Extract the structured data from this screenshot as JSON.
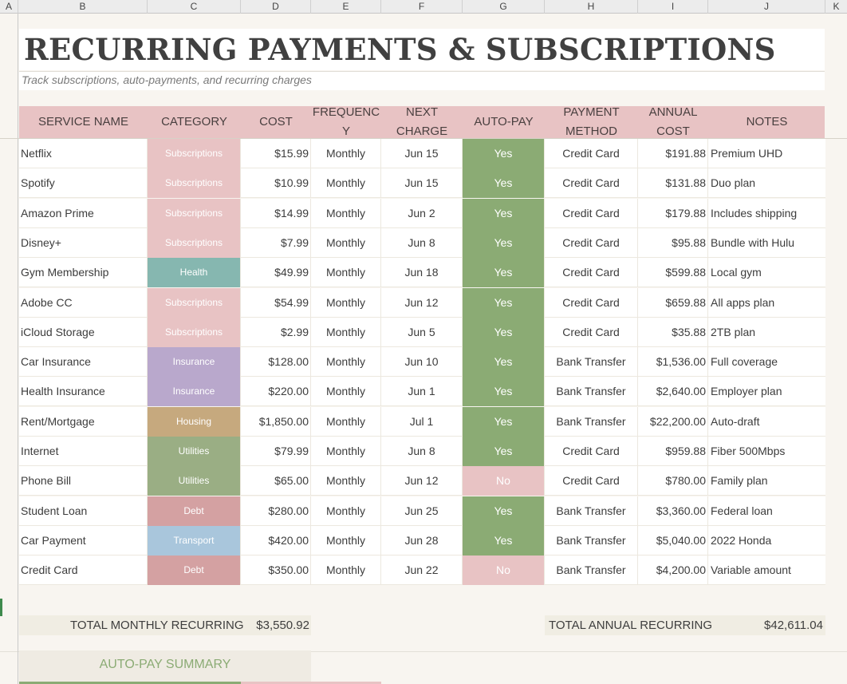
{
  "columns": [
    "A",
    "B",
    "C",
    "D",
    "E",
    "F",
    "G",
    "H",
    "I",
    "J",
    "K"
  ],
  "title": "RECURRING PAYMENTS & SUBSCRIPTIONS",
  "subtitle": "Track subscriptions, auto-payments, and recurring charges",
  "headers": {
    "service": "SERVICE NAME",
    "category": "CATEGORY",
    "cost": "COST",
    "frequency": "FREQUENC\nY",
    "next_charge": "NEXT\nCHARGE",
    "autopay": "AUTO-PAY",
    "payment_method": "PAYMENT\nMETHOD",
    "annual_cost": "ANNUAL\nCOST",
    "notes": "NOTES"
  },
  "category_colors": {
    "Subscriptions": "#e8c3c4",
    "Health": "#86b7b0",
    "Insurance": "#b9a8cc",
    "Housing": "#c6a97e",
    "Utilities": "#9aae84",
    "Debt": "#d4a1a2",
    "Transport": "#a9c6dc"
  },
  "autopay_colors": {
    "Yes": "#8bab74",
    "No": "#e8c3c4"
  },
  "rows": [
    {
      "service": "Netflix",
      "category": "Subscriptions",
      "cost": "$15.99",
      "frequency": "Monthly",
      "next_charge": "Jun 15",
      "autopay": "Yes",
      "payment_method": "Credit Card",
      "annual_cost": "$191.88",
      "notes": "Premium UHD"
    },
    {
      "service": "Spotify",
      "category": "Subscriptions",
      "cost": "$10.99",
      "frequency": "Monthly",
      "next_charge": "Jun 15",
      "autopay": "Yes",
      "payment_method": "Credit Card",
      "annual_cost": "$131.88",
      "notes": "Duo plan"
    },
    {
      "service": "Amazon Prime",
      "category": "Subscriptions",
      "cost": "$14.99",
      "frequency": "Monthly",
      "next_charge": "Jun 2",
      "autopay": "Yes",
      "payment_method": "Credit Card",
      "annual_cost": "$179.88",
      "notes": "Includes shipping"
    },
    {
      "service": "Disney+",
      "category": "Subscriptions",
      "cost": "$7.99",
      "frequency": "Monthly",
      "next_charge": "Jun 8",
      "autopay": "Yes",
      "payment_method": "Credit Card",
      "annual_cost": "$95.88",
      "notes": "Bundle with Hulu"
    },
    {
      "service": "Gym Membership",
      "category": "Health",
      "cost": "$49.99",
      "frequency": "Monthly",
      "next_charge": "Jun 18",
      "autopay": "Yes",
      "payment_method": "Credit Card",
      "annual_cost": "$599.88",
      "notes": "Local gym"
    },
    {
      "service": "Adobe CC",
      "category": "Subscriptions",
      "cost": "$54.99",
      "frequency": "Monthly",
      "next_charge": "Jun 12",
      "autopay": "Yes",
      "payment_method": "Credit Card",
      "annual_cost": "$659.88",
      "notes": "All apps plan"
    },
    {
      "service": "iCloud Storage",
      "category": "Subscriptions",
      "cost": "$2.99",
      "frequency": "Monthly",
      "next_charge": "Jun 5",
      "autopay": "Yes",
      "payment_method": "Credit Card",
      "annual_cost": "$35.88",
      "notes": "2TB plan"
    },
    {
      "service": "Car Insurance",
      "category": "Insurance",
      "cost": "$128.00",
      "frequency": "Monthly",
      "next_charge": "Jun 10",
      "autopay": "Yes",
      "payment_method": "Bank Transfer",
      "annual_cost": "$1,536.00",
      "notes": "Full coverage"
    },
    {
      "service": "Health Insurance",
      "category": "Insurance",
      "cost": "$220.00",
      "frequency": "Monthly",
      "next_charge": "Jun 1",
      "autopay": "Yes",
      "payment_method": "Bank Transfer",
      "annual_cost": "$2,640.00",
      "notes": "Employer plan"
    },
    {
      "service": "Rent/Mortgage",
      "category": "Housing",
      "cost": "$1,850.00",
      "frequency": "Monthly",
      "next_charge": "Jul 1",
      "autopay": "Yes",
      "payment_method": "Bank Transfer",
      "annual_cost": "$22,200.00",
      "notes": "Auto-draft"
    },
    {
      "service": "Internet",
      "category": "Utilities",
      "cost": "$79.99",
      "frequency": "Monthly",
      "next_charge": "Jun 8",
      "autopay": "Yes",
      "payment_method": "Credit Card",
      "annual_cost": "$959.88",
      "notes": "Fiber 500Mbps"
    },
    {
      "service": "Phone Bill",
      "category": "Utilities",
      "cost": "$65.00",
      "frequency": "Monthly",
      "next_charge": "Jun 12",
      "autopay": "No",
      "payment_method": "Credit Card",
      "annual_cost": "$780.00",
      "notes": "Family plan"
    },
    {
      "service": "Student Loan",
      "category": "Debt",
      "cost": "$280.00",
      "frequency": "Monthly",
      "next_charge": "Jun 25",
      "autopay": "Yes",
      "payment_method": "Bank Transfer",
      "annual_cost": "$3,360.00",
      "notes": "Federal loan"
    },
    {
      "service": "Car Payment",
      "category": "Transport",
      "cost": "$420.00",
      "frequency": "Monthly",
      "next_charge": "Jun 28",
      "autopay": "Yes",
      "payment_method": "Bank Transfer",
      "annual_cost": "$5,040.00",
      "notes": "2022 Honda"
    },
    {
      "service": "Credit Card",
      "category": "Debt",
      "cost": "$350.00",
      "frequency": "Monthly",
      "next_charge": "Jun 22",
      "autopay": "No",
      "payment_method": "Bank Transfer",
      "annual_cost": "$4,200.00",
      "notes": "Variable amount"
    }
  ],
  "totals": {
    "monthly_label": "TOTAL MONTHLY RECURRING",
    "monthly_value": "$3,550.92",
    "annual_label": "TOTAL ANNUAL RECURRING",
    "annual_value": "$42,611.04"
  },
  "autopay_summary_title": "AUTO-PAY SUMMARY"
}
